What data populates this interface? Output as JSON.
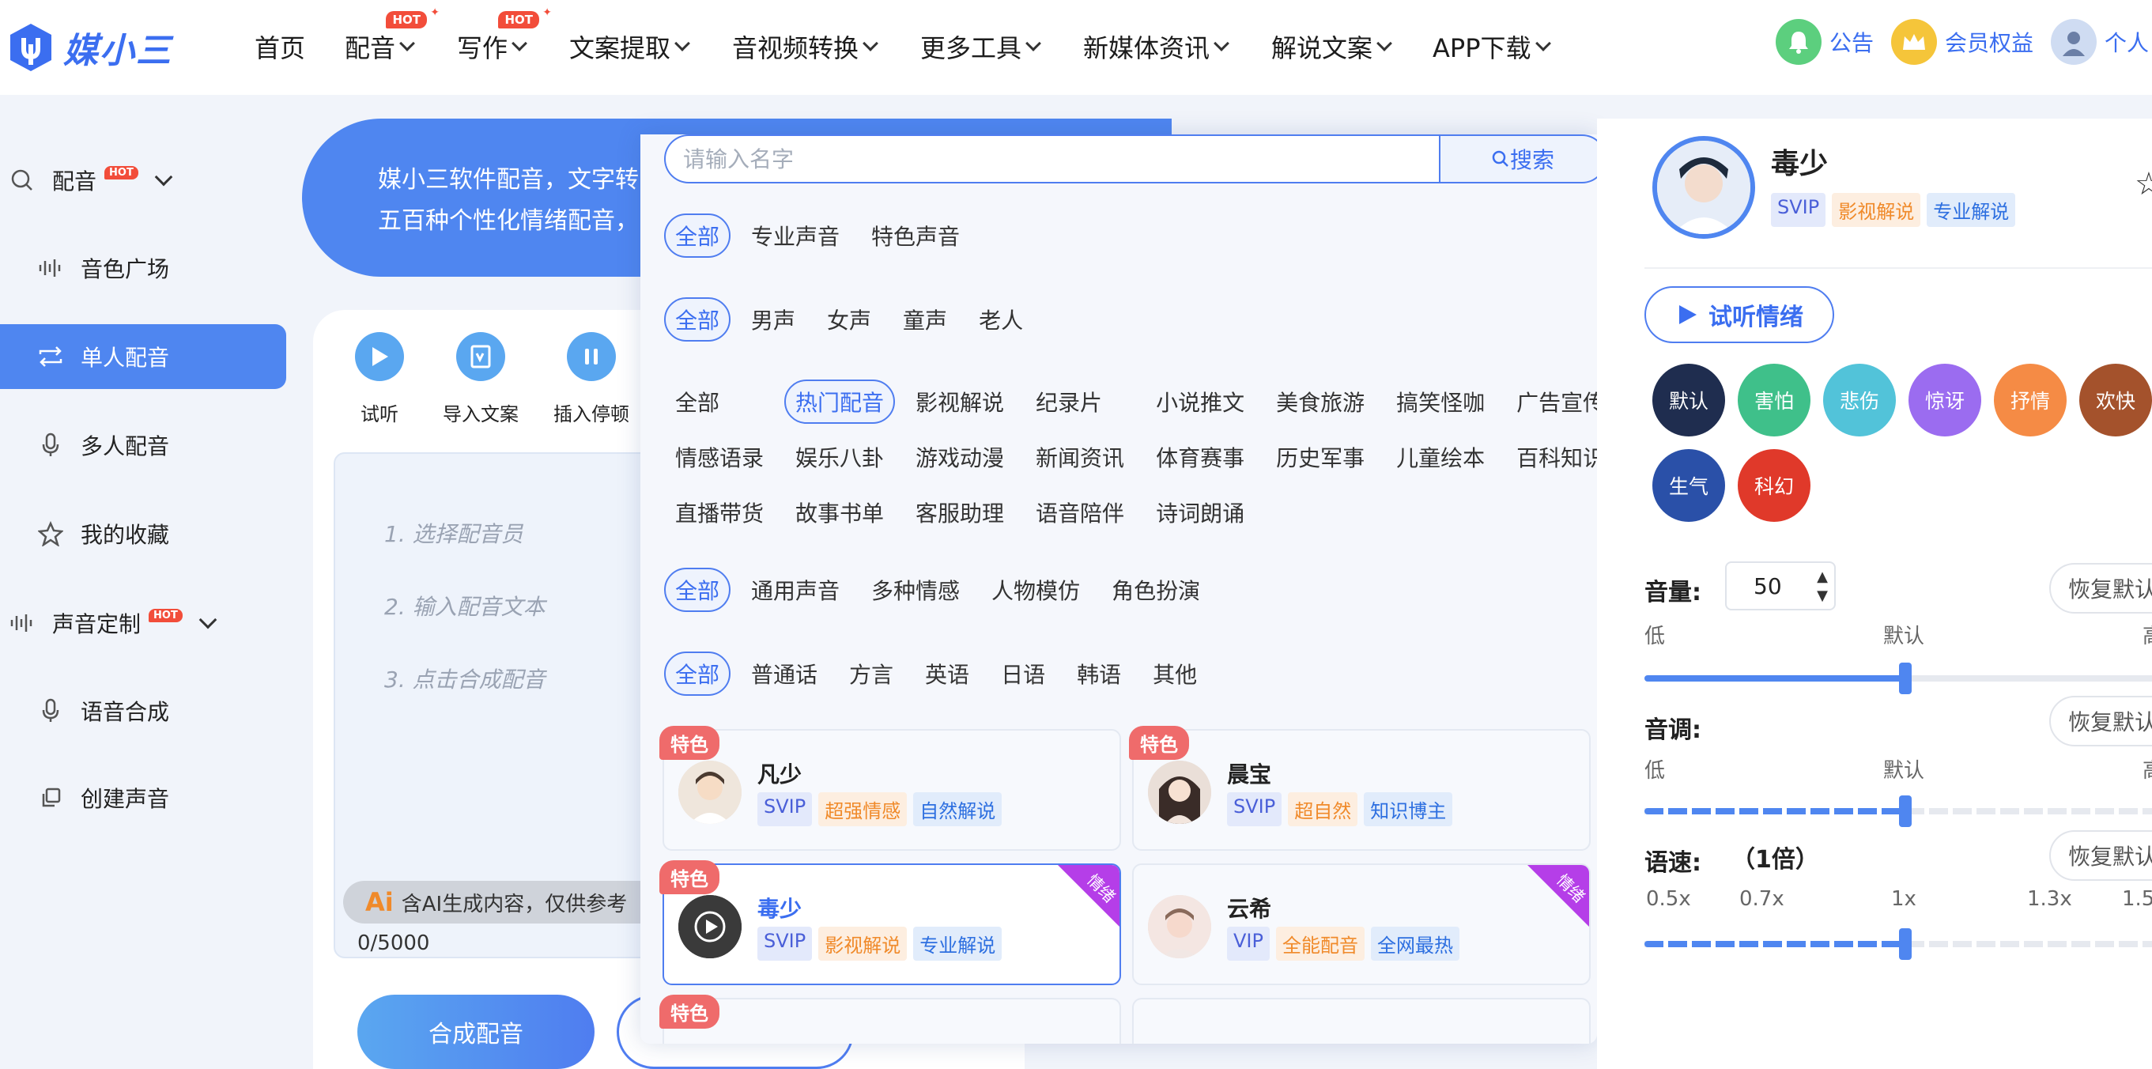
{
  "nav": {
    "logo_text": "媒小三",
    "items": [
      {
        "label": "首页",
        "has_chevron": false,
        "hot": false
      },
      {
        "label": "配音",
        "has_chevron": true,
        "hot": true
      },
      {
        "label": "写作",
        "has_chevron": true,
        "hot": true
      },
      {
        "label": "文案提取",
        "has_chevron": true,
        "hot": false
      },
      {
        "label": "音视频转换",
        "has_chevron": true,
        "hot": false
      },
      {
        "label": "更多工具",
        "has_chevron": true,
        "hot": false
      },
      {
        "label": "新媒体资讯",
        "has_chevron": true,
        "hot": false
      },
      {
        "label": "解说文案",
        "has_chevron": true,
        "hot": false
      },
      {
        "label": "APP下载",
        "has_chevron": true,
        "hot": false
      }
    ],
    "hot_badge": "HOT",
    "announce": "公告",
    "membership": "会员权益",
    "profile": "个人"
  },
  "sidebar": {
    "group1": "配音",
    "items1": [
      "音色广场",
      "单人配音",
      "多人配音",
      "我的收藏"
    ],
    "group2": "声音定制",
    "items2": [
      "语音合成",
      "创建声音"
    ],
    "active": "单人配音"
  },
  "banner": {
    "line1": "媒小三软件配音，文字转",
    "line2": "五百种个性化情绪配音，"
  },
  "toolbar": [
    "试听",
    "导入文案",
    "插入停顿"
  ],
  "editor": {
    "steps": [
      "1. 选择配音员",
      "2. 输入配音文本",
      "3. 点击合成配音"
    ],
    "ai_prefix": "Ai",
    "ai_note": "含AI生成内容，仅供参考",
    "char_count": "0/5000",
    "synth_button": "合成配音"
  },
  "picker": {
    "search_placeholder": "请输入名字",
    "search_button": "搜索",
    "row1": [
      "全部",
      "专业声音",
      "特色声音"
    ],
    "row2": [
      "全部",
      "男声",
      "女声",
      "童声",
      "老人"
    ],
    "categories": [
      "全部",
      "热门配音",
      "影视解说",
      "纪录片",
      "小说推文",
      "美食旅游",
      "搞笑怪咖",
      "广告宣传",
      "情感语录",
      "娱乐八卦",
      "游戏动漫",
      "新闻资讯",
      "体育赛事",
      "历史军事",
      "儿童绘本",
      "百科知识",
      "直播带货",
      "故事书单",
      "客服助理",
      "语音陪伴",
      "诗词朗诵"
    ],
    "categories_active": "热门配音",
    "row4": [
      "全部",
      "通用声音",
      "多种情感",
      "人物模仿",
      "角色扮演"
    ],
    "row5": [
      "全部",
      "普通话",
      "方言",
      "英语",
      "日语",
      "韩语",
      "其他"
    ],
    "voices": [
      {
        "name": "凡少",
        "special": "特色",
        "emotion": "",
        "tags": [
          "SVIP",
          "超强情感",
          "自然解说"
        ]
      },
      {
        "name": "晨宝",
        "special": "特色",
        "emotion": "",
        "tags": [
          "SVIP",
          "超自然",
          "知识博主"
        ]
      },
      {
        "name": "毒少",
        "special": "特色",
        "emotion": "情绪",
        "tags": [
          "SVIP",
          "影视解说",
          "专业解说"
        ]
      },
      {
        "name": "云希",
        "special": "",
        "emotion": "情绪",
        "tags": [
          "VIP",
          "全能配音",
          "全网最热"
        ]
      }
    ],
    "partial_special": "特色"
  },
  "detail": {
    "name": "毒少",
    "tags": [
      "SVIP",
      "影视解说",
      "专业解说"
    ],
    "preview_button": "试听情绪",
    "emotions": [
      {
        "label": "默认",
        "color": "#1f2d4f"
      },
      {
        "label": "害怕",
        "color": "#3fc08a"
      },
      {
        "label": "悲伤",
        "color": "#52c3d9"
      },
      {
        "label": "惊讶",
        "color": "#9b6cf0"
      },
      {
        "label": "抒情",
        "color": "#f58b45"
      },
      {
        "label": "欢快",
        "color": "#a4522c"
      },
      {
        "label": "生气",
        "color": "#2a50a8"
      },
      {
        "label": "科幻",
        "color": "#e0392a"
      }
    ],
    "volume_label": "音量:",
    "volume_value": "50",
    "volume_level": 0.5,
    "reset_label": "恢复默认",
    "low": "低",
    "default": "默认",
    "high": "高",
    "pitch_label": "音调:",
    "pitch_level": 0.5,
    "speed_label": "语速:",
    "speed_value": "（1倍）",
    "speed_ticks": [
      "0.5x",
      "0.7x",
      "1x",
      "1.3x",
      "1.5"
    ],
    "speed_level": 0.5
  }
}
